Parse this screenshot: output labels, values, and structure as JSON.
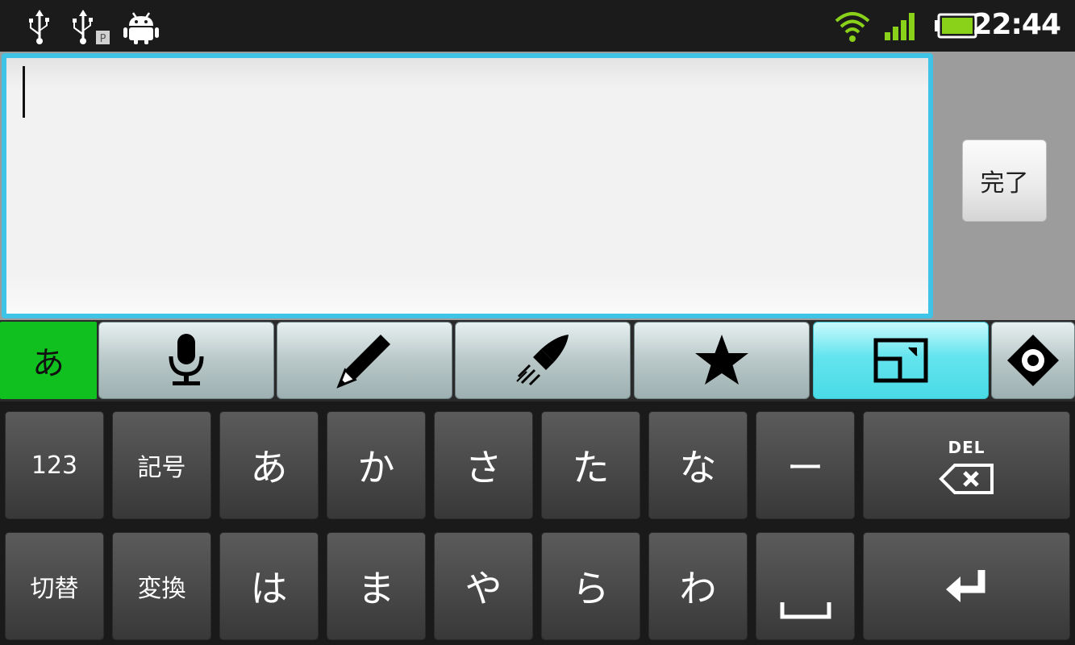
{
  "status_bar": {
    "time": "22:44",
    "icons": [
      "usb-icon",
      "usb-debug-icon",
      "android-icon",
      "wifi-icon",
      "signal-icon",
      "battery-icon"
    ]
  },
  "edit": {
    "done_label": "完了"
  },
  "toolbar": {
    "mode_label": "あ",
    "buttons": [
      "microphone-icon",
      "pencil-icon",
      "rocket-icon",
      "star-icon",
      "window-icon",
      "dpad-icon"
    ]
  },
  "keyboard": {
    "row1": [
      "123",
      "記号",
      "あ",
      "か",
      "さ",
      "た",
      "な",
      "ー"
    ],
    "row2": [
      "切替",
      "変換",
      "は",
      "ま",
      "や",
      "ら",
      "わ"
    ],
    "del_label": "DEL"
  },
  "colors": {
    "accent": "#3fc4e8",
    "mode_green": "#10c01e",
    "active_cyan": "#49dbe6",
    "battery_green": "#8ad11a"
  }
}
